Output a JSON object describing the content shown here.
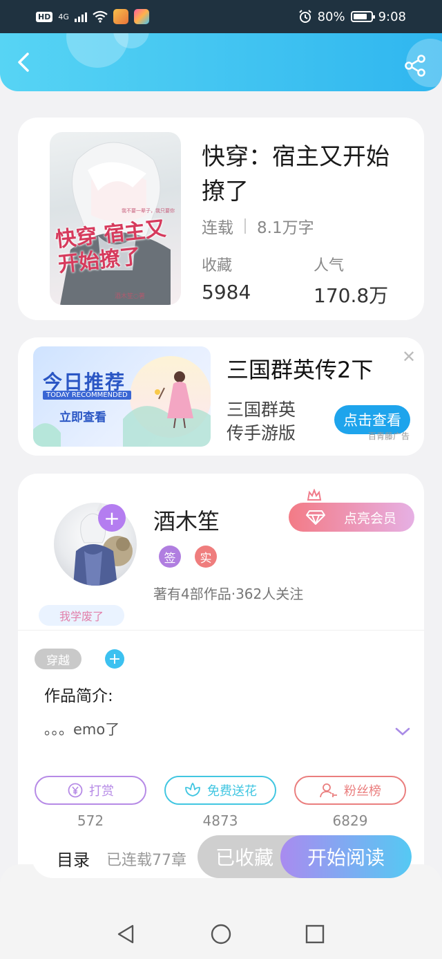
{
  "status_bar": {
    "hd": "HD",
    "network": "4G",
    "battery_percent": "80%",
    "battery_level": 0.8,
    "time": "9:08"
  },
  "header": {
    "back_icon": "chevron-left-icon",
    "share_icon": "share-icon",
    "accent_start": "#57d4f4",
    "accent_end": "#2fb6ef"
  },
  "book": {
    "title": "快穿：宿主又开始撩了",
    "status": "连载",
    "word_count": "8.1万字",
    "stats": [
      {
        "label": "收藏",
        "value": "5984"
      },
      {
        "label": "人气",
        "value": "170.8万"
      }
    ],
    "cover": {
      "title_text": "快穿 宿主又开始撩了",
      "tagline": "我不要一辈子，我只要你",
      "author_mark": "酒木笙○著"
    }
  },
  "ad": {
    "banner_title": "今日推荐",
    "banner_sub": "TODAY RECOMMENDED",
    "banner_cta": "立即查看",
    "name": "三国群英传2下",
    "description": "三国群英传手游版",
    "button": "点击查看",
    "source": "百青藤广告",
    "close_icon": "close-icon"
  },
  "author": {
    "name": "酒木笙",
    "badges": [
      {
        "label": "签",
        "color": "#b07ee0"
      },
      {
        "label": "实",
        "color": "#ef7d7d"
      }
    ],
    "summary": "著有4部作品·362人关注",
    "avatar_tag": "我学废了",
    "vip_button": "点亮会员",
    "follow_icon": "plus-icon"
  },
  "work": {
    "tags": [
      "穿越"
    ],
    "intro_title": "作品简介:",
    "intro_text": "。。。emo了",
    "actions": [
      {
        "label": "打赏",
        "icon": "yen-icon",
        "color": "#b68ae6",
        "count": "572"
      },
      {
        "label": "免费送花",
        "icon": "flower-icon",
        "color": "#41c6e1",
        "count": "4873"
      },
      {
        "label": "粉丝榜",
        "icon": "user-rank-icon",
        "color": "#ea7e7e",
        "count": "6829"
      }
    ]
  },
  "read_bar": {
    "toc": "目录",
    "chapters": "已连载77章",
    "collected": "已收藏",
    "start": "开始阅读"
  },
  "navbar": {
    "back": "triangle-back-icon",
    "home": "circle-home-icon",
    "recent": "square-recent-icon"
  }
}
